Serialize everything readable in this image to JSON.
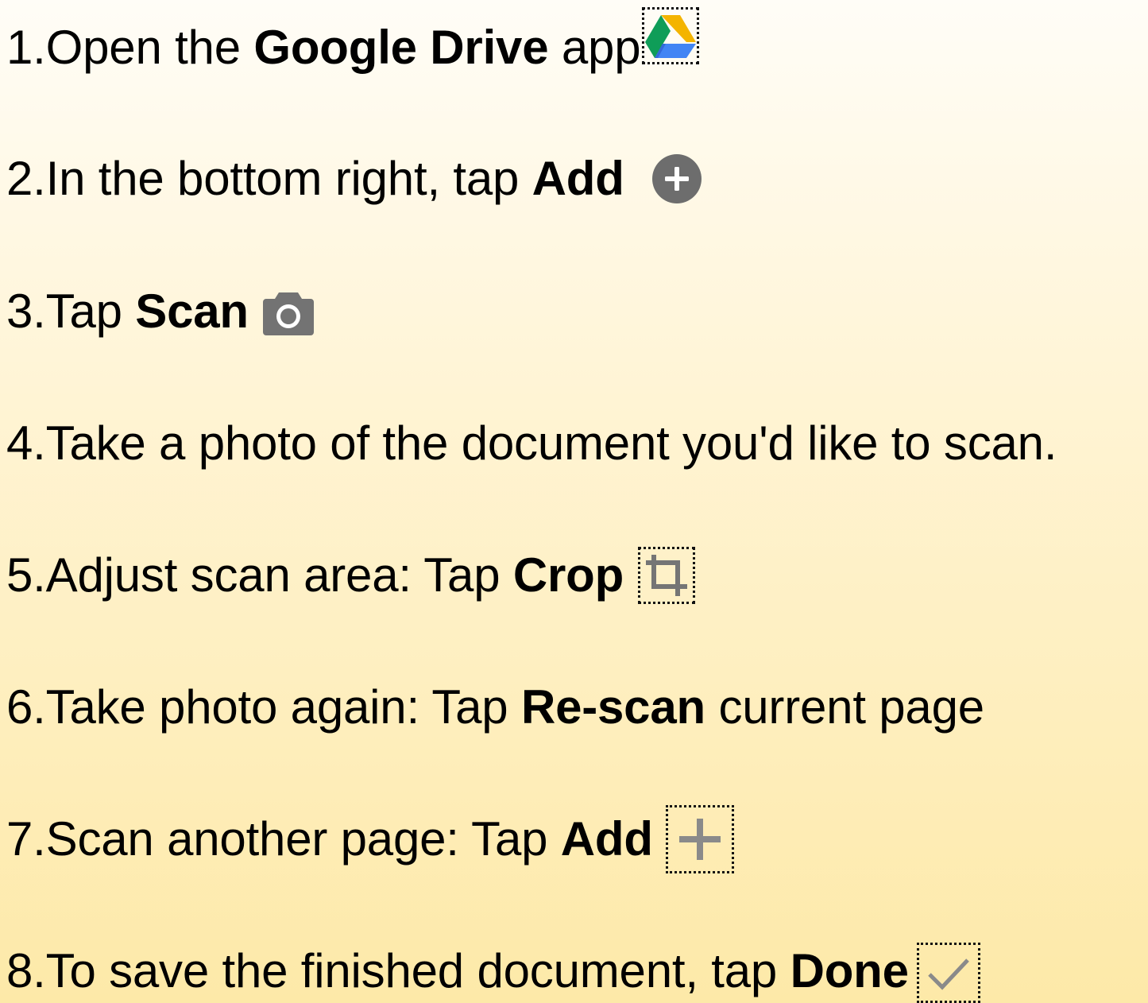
{
  "steps": [
    {
      "num": "1.",
      "pre": "Open the ",
      "bold": "Google Drive",
      "post": " app",
      "icon": "google-drive-icon"
    },
    {
      "num": "2.",
      "pre": "In the bottom right, tap ",
      "bold": "Add",
      "post": "",
      "icon": "add-circle-icon"
    },
    {
      "num": "3.",
      "pre": "Tap ",
      "bold": "Scan",
      "post": "",
      "icon": "camera-icon"
    },
    {
      "num": "4.",
      "pre": "Take a photo of the document you'd like to scan.",
      "bold": "",
      "post": "",
      "icon": ""
    },
    {
      "num": "5.",
      "pre": "Adjust scan area: Tap ",
      "bold": "Crop",
      "post": "",
      "icon": "crop-icon"
    },
    {
      "num": "6.",
      "pre": "Take photo again: Tap ",
      "bold": "Re-scan",
      "post": " current page",
      "icon": ""
    },
    {
      "num": "7.",
      "pre": "Scan another page: Tap ",
      "bold": "Add",
      "post": "",
      "icon": "plus-icon"
    },
    {
      "num": "8.",
      "pre": "To save the finished document, tap ",
      "bold": "Done",
      "post": "",
      "icon": "checkmark-icon"
    }
  ],
  "colors": {
    "icon_gray": "#6d6d6d",
    "drive_green": "#0f9d58",
    "drive_yellow": "#f4b400",
    "drive_blue": "#4285f4",
    "drive_dark_blue": "#2a56c6"
  }
}
